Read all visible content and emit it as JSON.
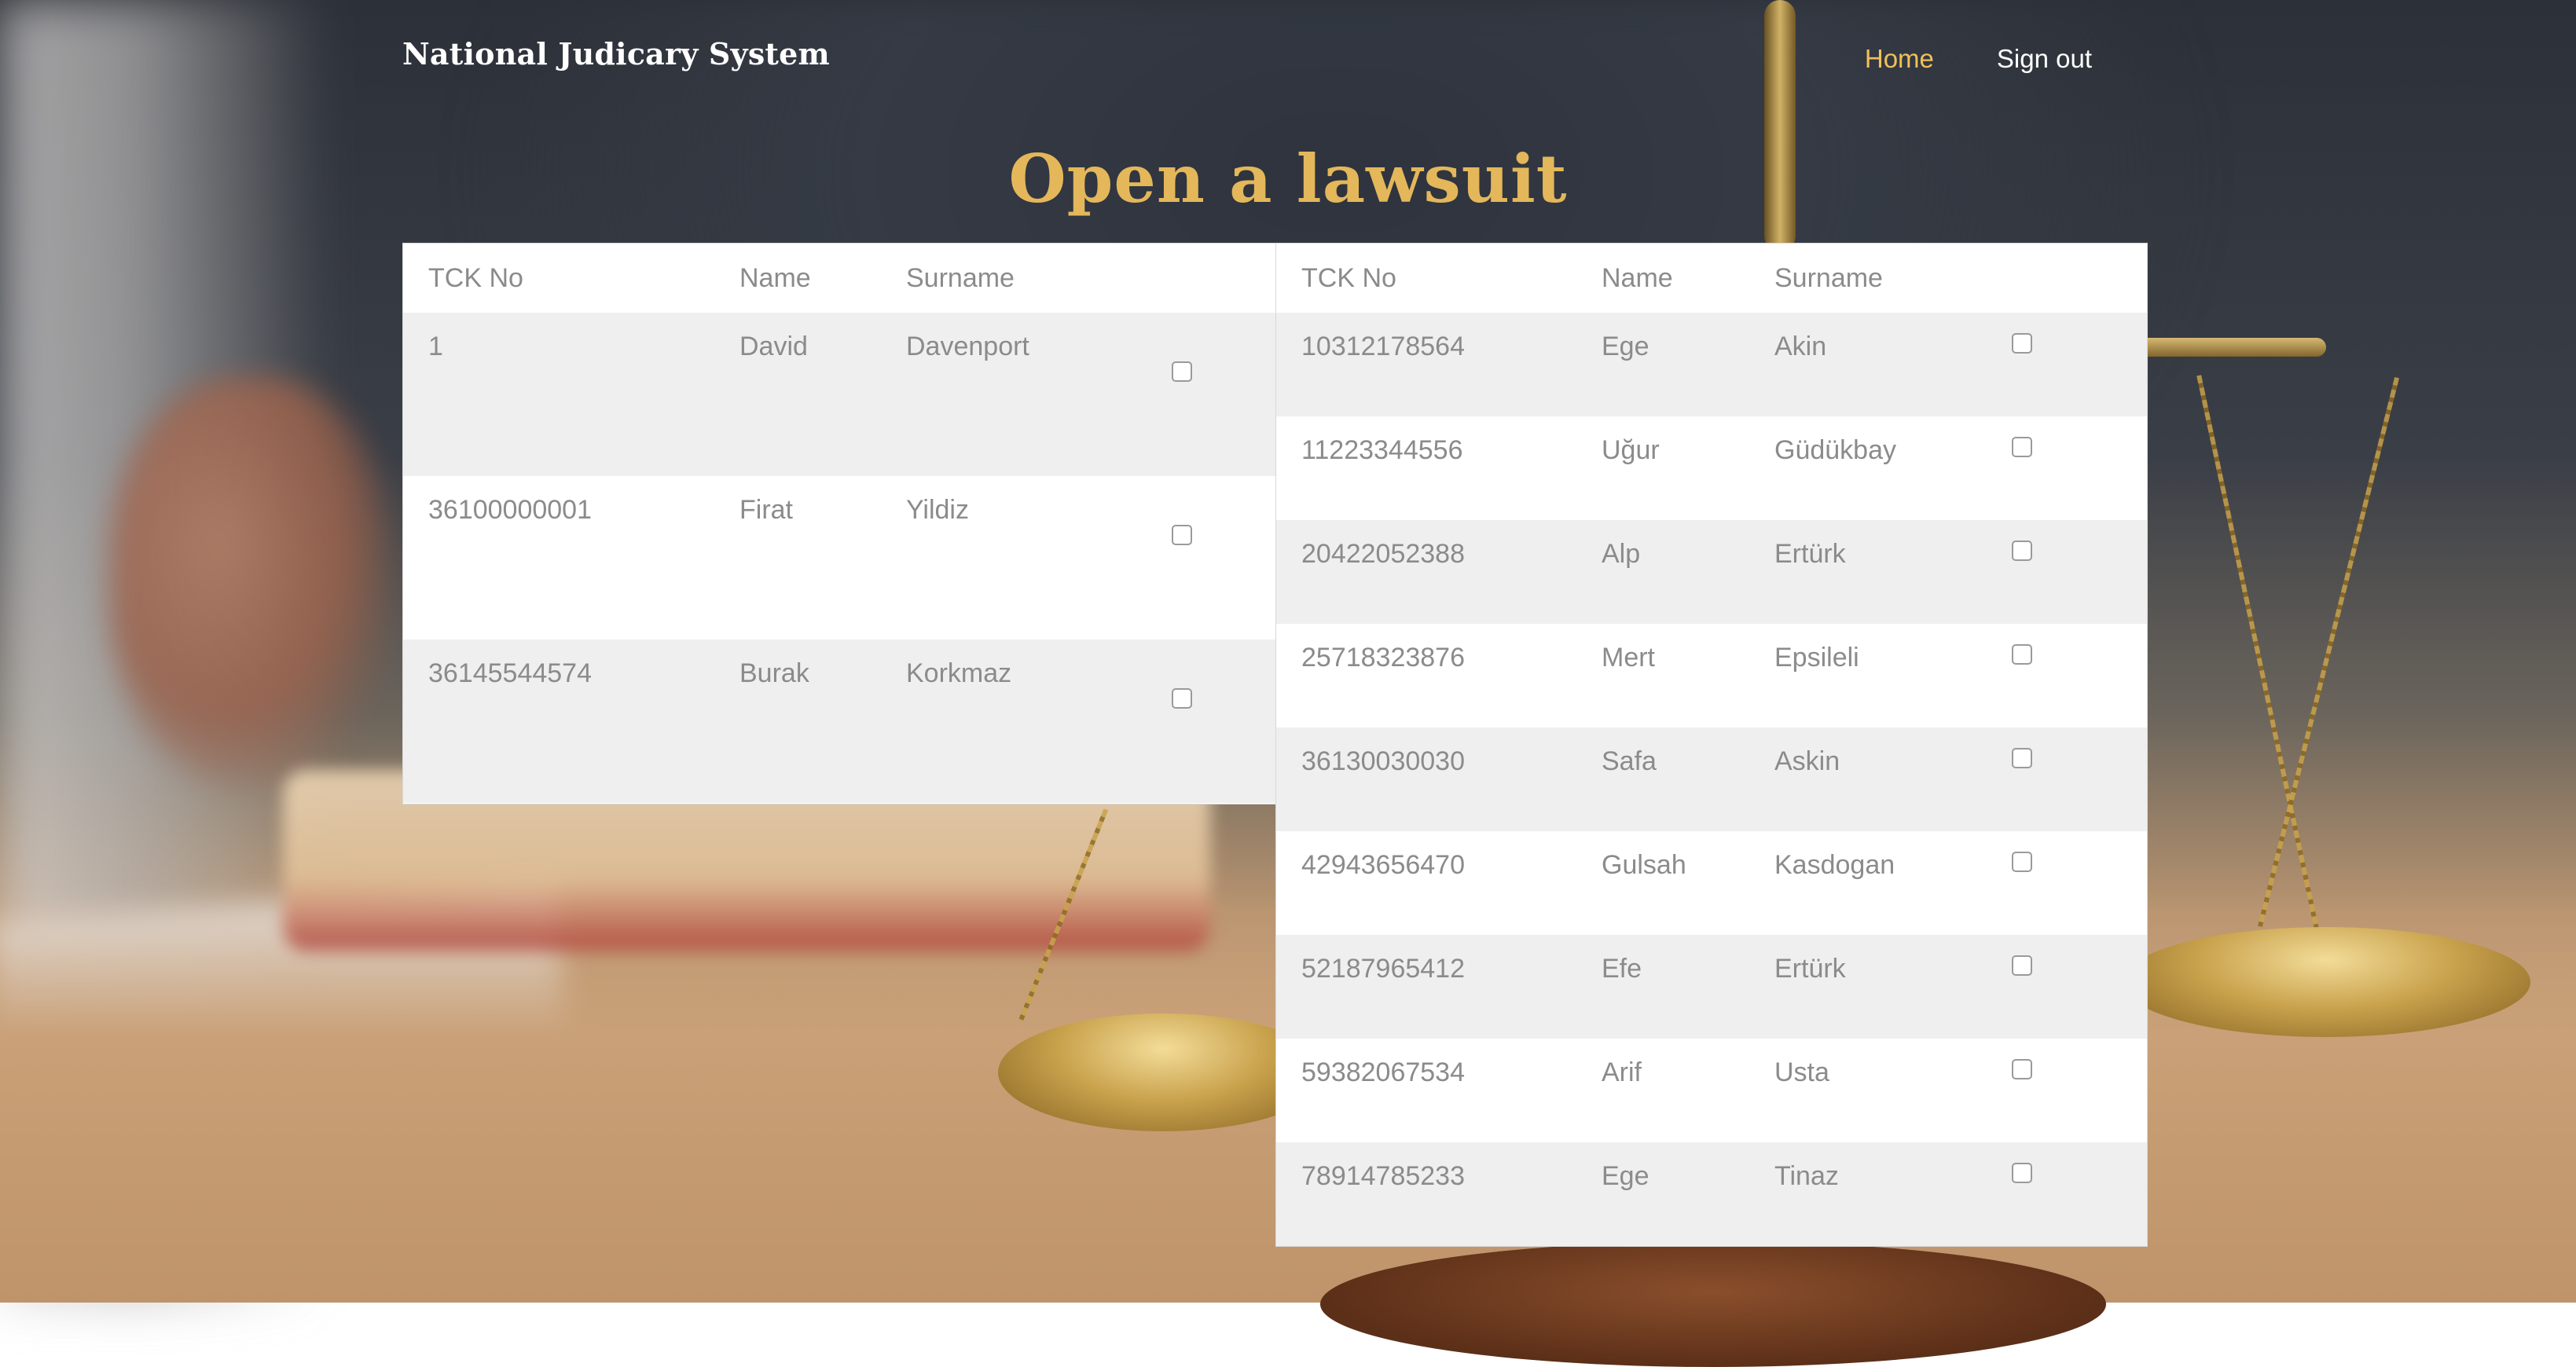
{
  "header": {
    "brand": "National Judicary System",
    "nav": [
      {
        "label": "Home",
        "active": true
      },
      {
        "label": "Sign out",
        "active": false
      }
    ]
  },
  "page_title": "Open a lawsuit",
  "colors": {
    "accent": "#e3b75a",
    "nav_active": "#f0c05a",
    "row_alt": "#efefef",
    "text_muted": "#8b8b8b"
  },
  "left_table": {
    "columns": [
      "TCK No",
      "Name",
      "Surname"
    ],
    "rows": [
      {
        "tck": "1",
        "name": "David",
        "surname": "Davenport",
        "checked": false
      },
      {
        "tck": "36100000001",
        "name": "Firat",
        "surname": "Yildiz",
        "checked": false
      },
      {
        "tck": "36145544574",
        "name": "Burak",
        "surname": "Korkmaz",
        "checked": false
      }
    ]
  },
  "right_table": {
    "columns": [
      "TCK No",
      "Name",
      "Surname"
    ],
    "rows": [
      {
        "tck": "10312178564",
        "name": "Ege",
        "surname": "Akin",
        "checked": false
      },
      {
        "tck": "11223344556",
        "name": "Uğur",
        "surname": "Güdükbay",
        "checked": false
      },
      {
        "tck": "20422052388",
        "name": "Alp",
        "surname": "Ertürk",
        "checked": false
      },
      {
        "tck": "25718323876",
        "name": "Mert",
        "surname": "Epsileli",
        "checked": false
      },
      {
        "tck": "36130030030",
        "name": "Safa",
        "surname": "Askin",
        "checked": false
      },
      {
        "tck": "42943656470",
        "name": "Gulsah",
        "surname": "Kasdogan",
        "checked": false
      },
      {
        "tck": "52187965412",
        "name": "Efe",
        "surname": "Ertürk",
        "checked": false
      },
      {
        "tck": "59382067534",
        "name": "Arif",
        "surname": "Usta",
        "checked": false
      },
      {
        "tck": "78914785233",
        "name": "Ege",
        "surname": "Tinaz",
        "checked": false
      }
    ]
  }
}
